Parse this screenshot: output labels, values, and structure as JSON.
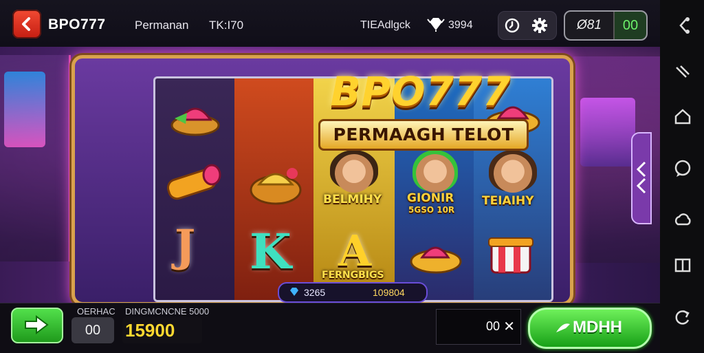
{
  "header": {
    "brand": "BPO777",
    "nav_1": "Permanan",
    "nav_2": "TK:I70",
    "nav_3": "TIEAdlgck",
    "gem_count": "3994",
    "balance_left": "Ø81",
    "balance_right": "00"
  },
  "game": {
    "logo_title": "BPO777",
    "logo_subtitle": "PERMAAGH TELOT",
    "reels": {
      "reel1": {
        "letter": "J"
      },
      "reel2": {
        "letter": "K"
      },
      "reel3": {
        "char_label": "BELMIHY",
        "letter": "A",
        "letter_label": "FERNGBIGS"
      },
      "reel4": {
        "char_label": "GIONIR",
        "char_sub": "5GSO 10R"
      },
      "reel5": {
        "char_label": "TEIAIHY"
      }
    },
    "win_left": "3265",
    "win_right": "109804"
  },
  "footer": {
    "bet_label": "OERHAC",
    "bet_value": "00",
    "credit_label": "DINGMCNCNE 5000",
    "credit_value": "15900",
    "amount_value": "00",
    "amount_clear": "✕",
    "play_label": "MDHH"
  },
  "colors": {
    "accent_green": "#32d22a",
    "brand_red": "#e13622",
    "gold": "#ffd22e"
  },
  "icons": [
    "back-arrow-icon",
    "gem-icon",
    "clock-icon",
    "gear-icon",
    "share-icon",
    "brush-icon",
    "home-icon",
    "chat-icon",
    "cloud-icon",
    "wallet-icon",
    "refresh-icon",
    "arrow-right-icon",
    "play-icon",
    "chevron-left-icon"
  ]
}
